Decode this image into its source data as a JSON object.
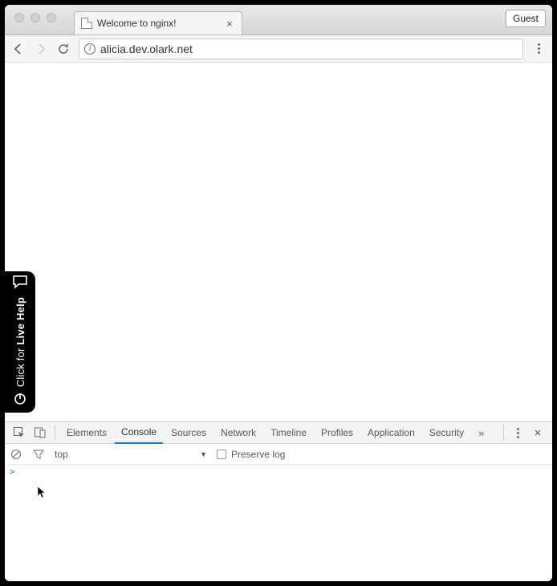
{
  "browser": {
    "tab_title": "Welcome to nginx!",
    "guest_label": "Guest",
    "url": "alicia.dev.olark.net"
  },
  "chat_widget": {
    "prefix": "Click for ",
    "bold": "Live Help"
  },
  "devtools": {
    "tabs": [
      "Elements",
      "Console",
      "Sources",
      "Network",
      "Timeline",
      "Profiles",
      "Application",
      "Security"
    ],
    "active_tab": "Console",
    "context": "top",
    "preserve_log_label": "Preserve log",
    "prompt": ">"
  }
}
